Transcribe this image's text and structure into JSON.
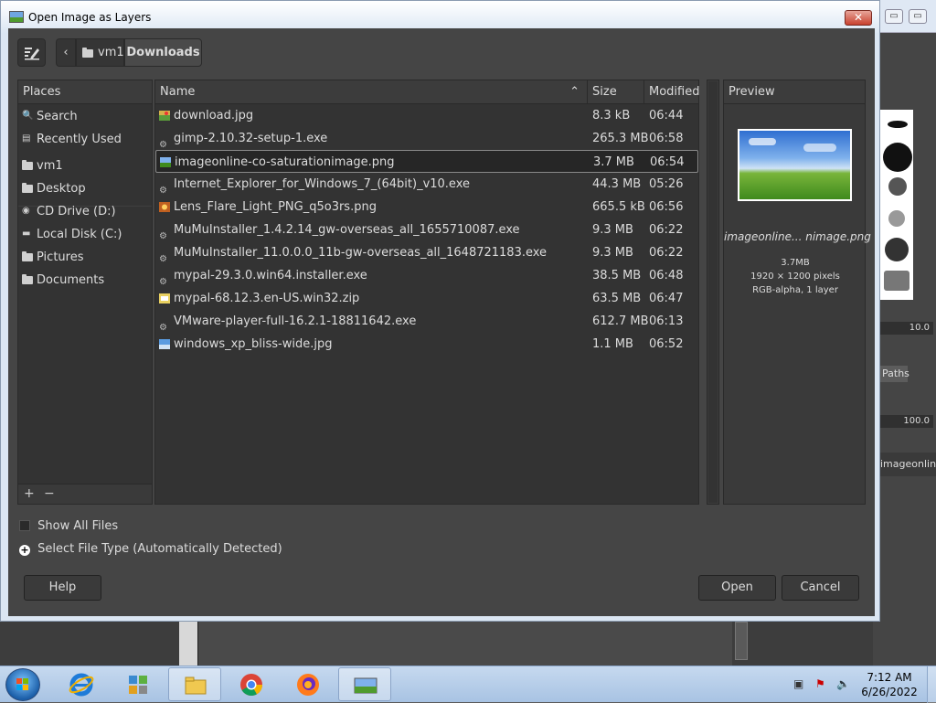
{
  "dialog": {
    "title": "Open Image as Layers",
    "close_label": "✕",
    "path": [
      "vm1",
      "Downloads"
    ],
    "places_header": "Places",
    "places": [
      {
        "label": "Search",
        "icon": "search-icon"
      },
      {
        "label": "Recently Used",
        "icon": "recent-icon"
      },
      {
        "label": "vm1",
        "icon": "folder-icon"
      },
      {
        "label": "Desktop",
        "icon": "folder-icon"
      },
      {
        "label": "CD Drive (D:)",
        "icon": "cd-drive-icon"
      },
      {
        "label": "Local Disk (C:)",
        "icon": "disk-icon"
      },
      {
        "label": "Pictures",
        "icon": "folder-icon"
      },
      {
        "label": "Documents",
        "icon": "folder-icon"
      }
    ],
    "places_footer": {
      "add": "+",
      "remove": "−"
    },
    "columns": {
      "name": "Name",
      "size": "Size",
      "modified": "Modified"
    },
    "files": [
      {
        "name": "download.jpg",
        "size": "8.3 kB",
        "modified": "06:44",
        "type": "image"
      },
      {
        "name": "gimp-2.10.32-setup-1.exe",
        "size": "265.3 MB",
        "modified": "06:58",
        "type": "exe"
      },
      {
        "name": "imageonline-co-saturationimage.png",
        "size": "3.7 MB",
        "modified": "06:54",
        "type": "image",
        "selected": true
      },
      {
        "name": "Internet_Explorer_for_Windows_7_(64bit)_v10.exe",
        "size": "44.3 MB",
        "modified": "05:26",
        "type": "exe"
      },
      {
        "name": "Lens_Flare_Light_PNG_q5o3rs.png",
        "size": "665.5 kB",
        "modified": "06:56",
        "type": "image"
      },
      {
        "name": "MuMuInstaller_1.4.2.14_gw-overseas_all_1655710087.exe",
        "size": "9.3 MB",
        "modified": "06:22",
        "type": "exe"
      },
      {
        "name": "MuMuInstaller_11.0.0.0_11b-gw-overseas_all_1648721183.exe",
        "size": "9.3 MB",
        "modified": "06:22",
        "type": "exe"
      },
      {
        "name": "mypal-29.3.0.win64.installer.exe",
        "size": "38.5 MB",
        "modified": "06:48",
        "type": "exe"
      },
      {
        "name": "mypal-68.12.3.en-US.win32.zip",
        "size": "63.5 MB",
        "modified": "06:47",
        "type": "zip"
      },
      {
        "name": "VMware-player-full-16.2.1-18811642.exe",
        "size": "612.7 MB",
        "modified": "06:13",
        "type": "exe"
      },
      {
        "name": "windows_xp_bliss-wide.jpg",
        "size": "1.1 MB",
        "modified": "06:52",
        "type": "image"
      }
    ],
    "preview": {
      "header": "Preview",
      "name": "imageonline... nimage.png",
      "size": "3.7MB",
      "dimensions": "1920 × 1200 pixels",
      "mode": "RGB-alpha, 1 layer"
    },
    "show_all_files": "Show All Files",
    "select_file_type": "Select File Type (Automatically Detected)",
    "buttons": {
      "help": "Help",
      "open": "Open",
      "cancel": "Cancel"
    }
  },
  "gimp_background": {
    "field1": "10.0",
    "tab_paths": "Paths",
    "field2": "100.0",
    "layer_name": "imageonline-co-s"
  },
  "taskbar": {
    "apps": [
      "internet-explorer-icon",
      "network-tool-icon",
      "file-explorer-icon",
      "chrome-icon",
      "firefox-icon",
      "gimp-icon"
    ],
    "time": "7:12 AM",
    "date": "6/26/2022"
  },
  "colors": {
    "dialog_bg": "#454545",
    "panel_bg": "#333333",
    "selection_border": "#8a8a8a",
    "close_button": "#c8412e"
  }
}
